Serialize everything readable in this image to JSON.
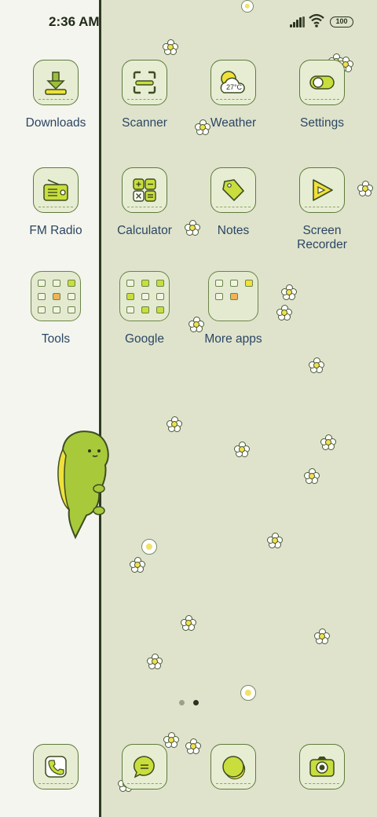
{
  "status_bar": {
    "time": "2:36 AM",
    "battery": "100"
  },
  "apps": [
    {
      "label": "Downloads",
      "icon": "download-icon"
    },
    {
      "label": "Scanner",
      "icon": "scanner-icon"
    },
    {
      "label": "Weather",
      "icon": "weather-icon",
      "badge": "27°C"
    },
    {
      "label": "Settings",
      "icon": "settings-icon"
    },
    {
      "label": "FM Radio",
      "icon": "radio-icon"
    },
    {
      "label": "Calculator",
      "icon": "calculator-icon"
    },
    {
      "label": "Notes",
      "icon": "notes-icon"
    },
    {
      "label": "Screen\nRecorder",
      "icon": "screen-recorder-icon"
    },
    {
      "label": "Tools",
      "icon": "tools-folder-icon"
    },
    {
      "label": "Google",
      "icon": "google-folder-icon"
    },
    {
      "label": "More apps",
      "icon": "more-apps-folder-icon"
    }
  ],
  "dock": [
    {
      "icon": "phone-icon"
    },
    {
      "icon": "messages-icon"
    },
    {
      "icon": "browser-icon"
    },
    {
      "icon": "camera-icon"
    }
  ],
  "page_indicator": {
    "count": 2,
    "active": 2
  },
  "colors": {
    "accent": "#c9de3c",
    "outline": "#5d7a3c",
    "label": "#2b4663",
    "wallpaper": "#dfe3cc"
  }
}
